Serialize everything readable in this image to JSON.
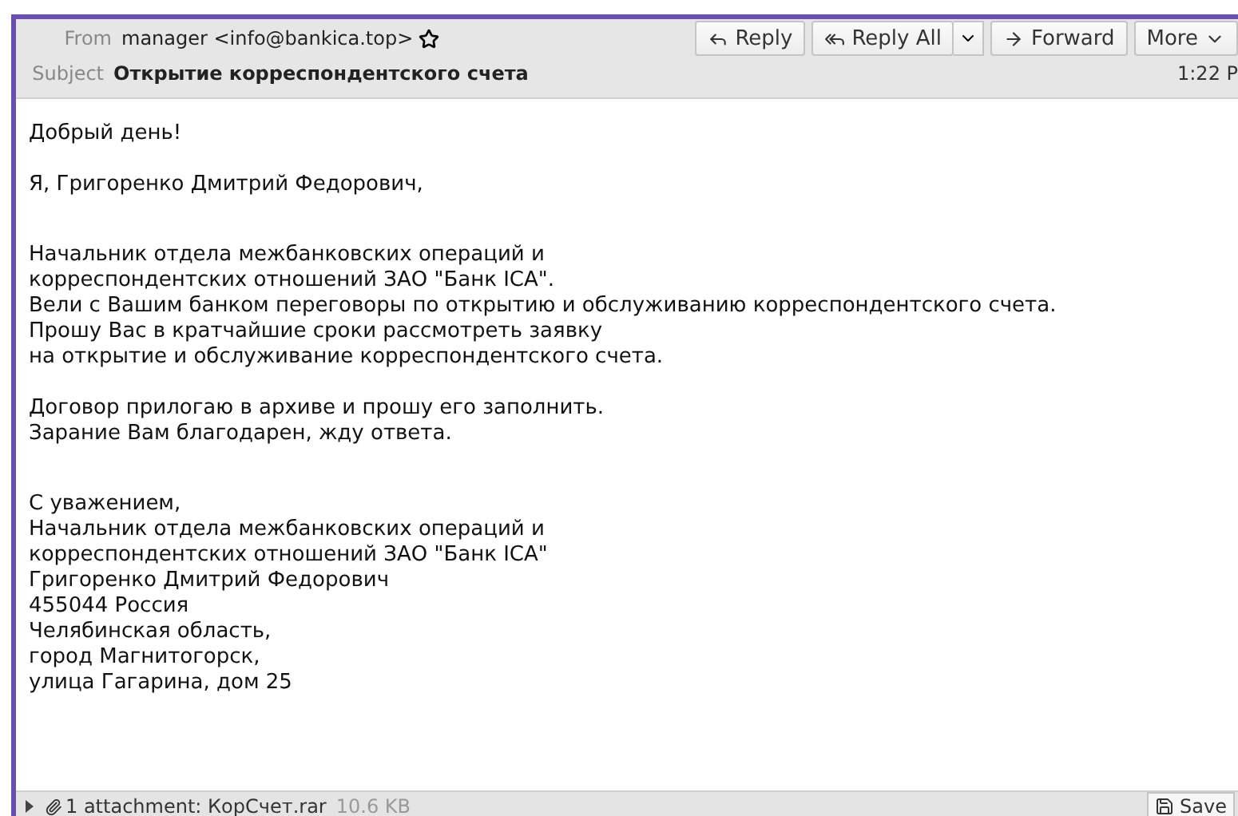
{
  "header": {
    "from_label": "From",
    "from_value": "manager <info@bankica.top>",
    "subject_label": "Subject",
    "subject_value": "Открытие корреспондентского счета",
    "time": "1:22 P",
    "buttons": [
      {
        "kind": "reply",
        "label": "Reply"
      },
      {
        "kind": "reply_all",
        "label": "Reply All"
      },
      {
        "kind": "forward",
        "label": "Forward"
      },
      {
        "kind": "more",
        "label": "More"
      }
    ]
  },
  "body": [
    {
      "lines": [
        "Добрый день!"
      ]
    },
    {
      "lines": [
        "Я, Григоренко Дмитрий Федорович,"
      ]
    },
    {
      "lines": [
        "Начальник отдела межбанковских операций и",
        "корреспондентских отношений ЗАО \"Банк ICA\".",
        "Вели с Вашим банком переговоры по открытию и обслуживанию корреспондентского счета.",
        "Прошу Вас в кратчайшие сроки рассмотреть заявку",
        "на открытие и обслуживание корреспондентского счета."
      ]
    },
    {
      "lines": [
        "Договор прилогаю в архиве и прошу его заполнить.",
        "Зарание Вам благодарен, жду ответа."
      ]
    },
    {
      "lines": [
        "С уважением,",
        "Начальник отдела межбанковских операций и",
        "корреспондентских отношений ЗАО \"Банк ICA\"",
        "Григоренко Дмитрий Федорович",
        "455044 Россия",
        "Челябинская область,",
        "город Магнитогорск,",
        "улица Гагарина, дом 25"
      ]
    }
  ],
  "attachment": {
    "expanded": false,
    "summary": "1 attachment: КорСчет.rar",
    "size": "10.6 KB",
    "save_label": "Save"
  }
}
